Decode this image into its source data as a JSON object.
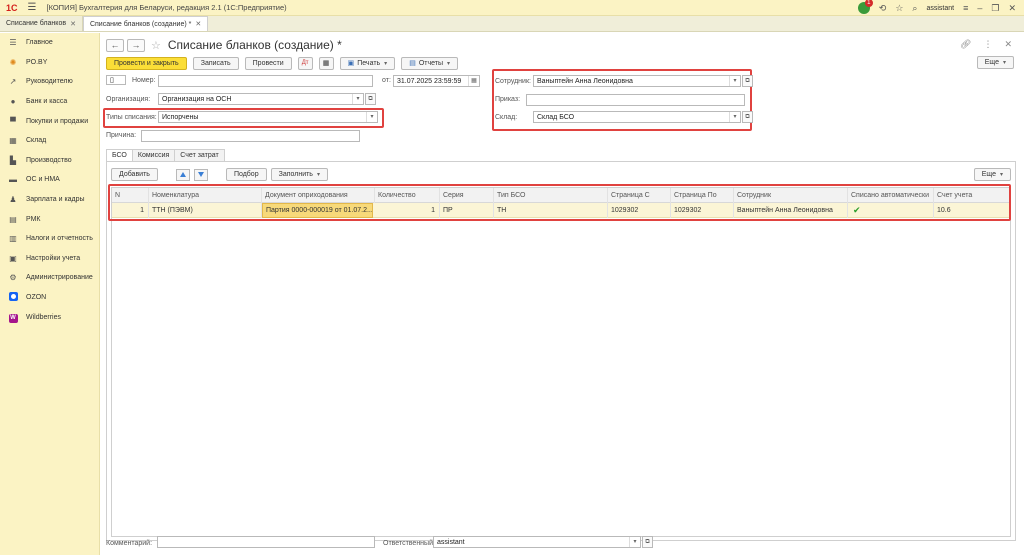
{
  "titlebar": {
    "logo": "1С",
    "app_title": "[КОПИЯ] Бухгалтерия для Беларуси, редакция 2.1  (1С:Предприятие)",
    "notifications": "1",
    "user": "assistant"
  },
  "tabs": [
    {
      "label": "Списание бланков"
    },
    {
      "label": "Списание бланков (создание) *"
    }
  ],
  "sidebar": {
    "items": [
      {
        "label": "Главное",
        "icon": "list-icon"
      },
      {
        "label": "PO.BY",
        "icon": "sun-icon"
      },
      {
        "label": "Руководителю",
        "icon": "trend-icon"
      },
      {
        "label": "Банк и касса",
        "icon": "bank-icon"
      },
      {
        "label": "Покупки и продажи",
        "icon": "cart-icon"
      },
      {
        "label": "Склад",
        "icon": "warehouse-icon"
      },
      {
        "label": "Производство",
        "icon": "factory-icon"
      },
      {
        "label": "ОС и НМА",
        "icon": "truck-icon"
      },
      {
        "label": "Зарплата и кадры",
        "icon": "people-icon"
      },
      {
        "label": "РМК",
        "icon": "register-icon"
      },
      {
        "label": "Налоги и отчетность",
        "icon": "tax-icon"
      },
      {
        "label": "Настройки учета",
        "icon": "settings-list-icon"
      },
      {
        "label": "Администрирование",
        "icon": "gear-icon"
      },
      {
        "label": "OZON",
        "icon": "ozon-icon"
      },
      {
        "label": "Wildberries",
        "icon": "wildberries-icon"
      }
    ]
  },
  "document": {
    "title": "Списание бланков (создание) *",
    "toolbar": {
      "post_close": "Провести и закрыть",
      "save": "Записать",
      "post": "Провести",
      "print": "Печать",
      "reports": "Отчеты",
      "more": "Еще"
    },
    "form": {
      "number_label": "Номер:",
      "number_value": "",
      "date_label": "от:",
      "date_value": "31.07.2025 23:59:59",
      "org_label": "Организация:",
      "org_value": "Организация на ОСН",
      "writeoff_type_label": "Типы списания:",
      "writeoff_type_value": "Испорчены",
      "reason_label": "Причина:",
      "reason_value": "",
      "employee_label": "Сотрудник:",
      "employee_value": "Ваныптейн Анна Леонидовна",
      "order_label": "Приказ:",
      "order_value": "",
      "warehouse_label": "Склад:",
      "warehouse_value": "Склад БСО"
    },
    "subtabs": [
      "БСО",
      "Комиссия",
      "Счет затрат"
    ],
    "table_toolbar": {
      "add": "Добавить",
      "pick": "Подбор",
      "fill": "Заполнить",
      "more": "Еще"
    },
    "table": {
      "columns": [
        "N",
        "Номенклатура",
        "Документ оприходования",
        "Количество",
        "Серия",
        "Тип БСО",
        "Страница С",
        "Страница По",
        "Сотрудник",
        "Списано автоматически",
        "Счет учета"
      ],
      "rows": [
        {
          "n": "1",
          "nomenclature": "ТТН (ПЭВМ)",
          "receipt_doc": "Партия 0000-000019 от 01.07.2...",
          "qty": "1",
          "series": "ПР",
          "bso_type": "ТН",
          "page_from": "1029302",
          "page_to": "1029302",
          "employee": "Ваныптейн Анна Леонидовна",
          "auto": "✔",
          "account": "10.6"
        }
      ]
    },
    "bottom": {
      "comment_label": "Комментарий:",
      "comment_value": "",
      "responsible_label": "Ответственный:",
      "responsible_value": "assistant"
    }
  },
  "colors": {
    "accent_yellow": "#fbde37",
    "sidebar_bg": "#fbf3c4",
    "highlight_red": "#e0423f",
    "selected_row": "#fbf5d6"
  }
}
